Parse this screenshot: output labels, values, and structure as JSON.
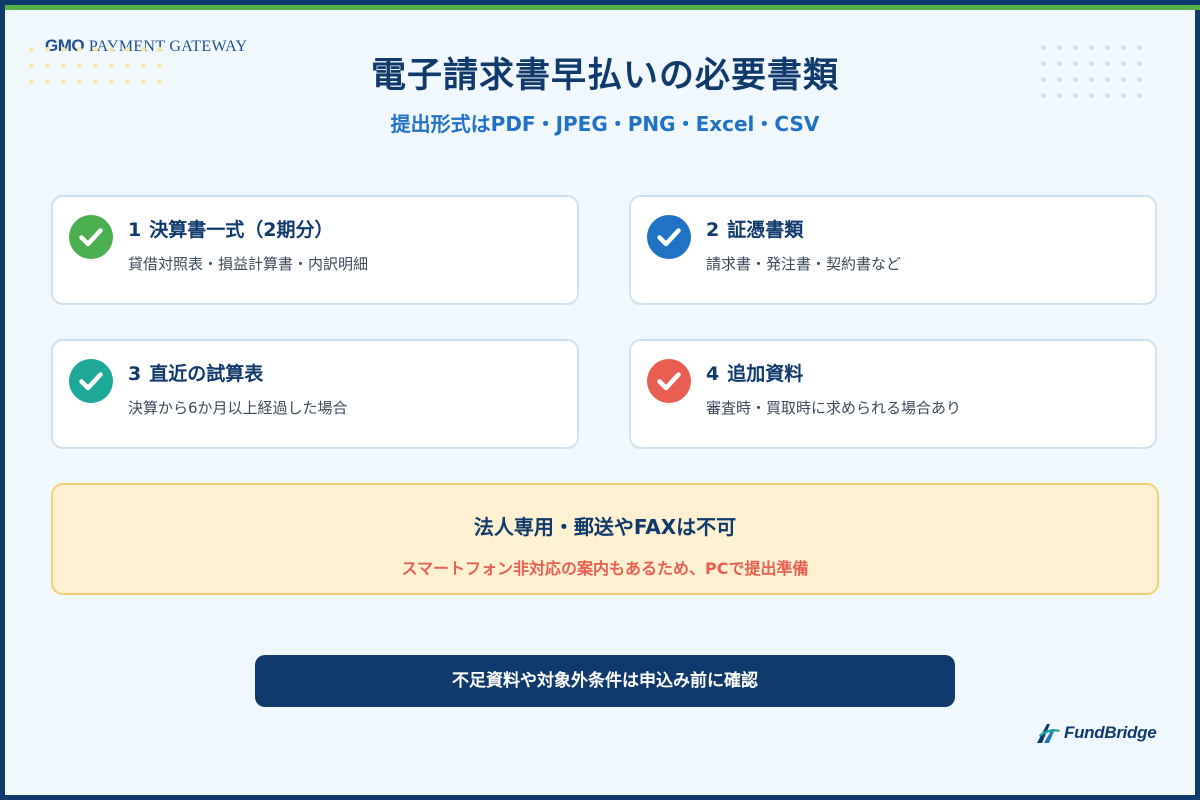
{
  "header": {
    "gmo_logo_mark": "GMO",
    "gmo_logo_text": "PAYMENT GATEWAY",
    "title": "電子請求書早払いの必要書類",
    "subtitle": "提出形式はPDF・JPEG・PNG・Excel・CSV"
  },
  "cards": [
    {
      "number": "1",
      "title": "決算書一式（2期分）",
      "description": "貸借対照表・損益計算書・内訳明細",
      "icon": "check-circle-icon",
      "color": "#4caf50"
    },
    {
      "number": "2",
      "title": "証憑書類",
      "description": "請求書・発注書・契約書など",
      "icon": "check-circle-icon",
      "color": "#1f72c4"
    },
    {
      "number": "3",
      "title": "直近の試算表",
      "description": "決算から6か月以上経過した場合",
      "icon": "check-circle-icon",
      "color": "#1ea89a"
    },
    {
      "number": "4",
      "title": "追加資料",
      "description": "審査時・買取時に求められる場合あり",
      "icon": "check-circle-icon",
      "color": "#e85f52"
    }
  ],
  "notice": {
    "title": "法人専用・郵送やFAXは不可",
    "subtitle": "スマートフォン非対応の案内もあるため、PCで提出準備"
  },
  "cta": {
    "label": "不足資料や対象外条件は申込み前に確認"
  },
  "footer": {
    "fundbridge_logo_text": "FundBridge"
  },
  "colors": {
    "navy": "#0f3a6b",
    "accent_blue": "#1f72c4",
    "warning_red": "#e85f52",
    "notice_bg": "#fdf1d2",
    "top_accent_green": "#55b04a"
  }
}
